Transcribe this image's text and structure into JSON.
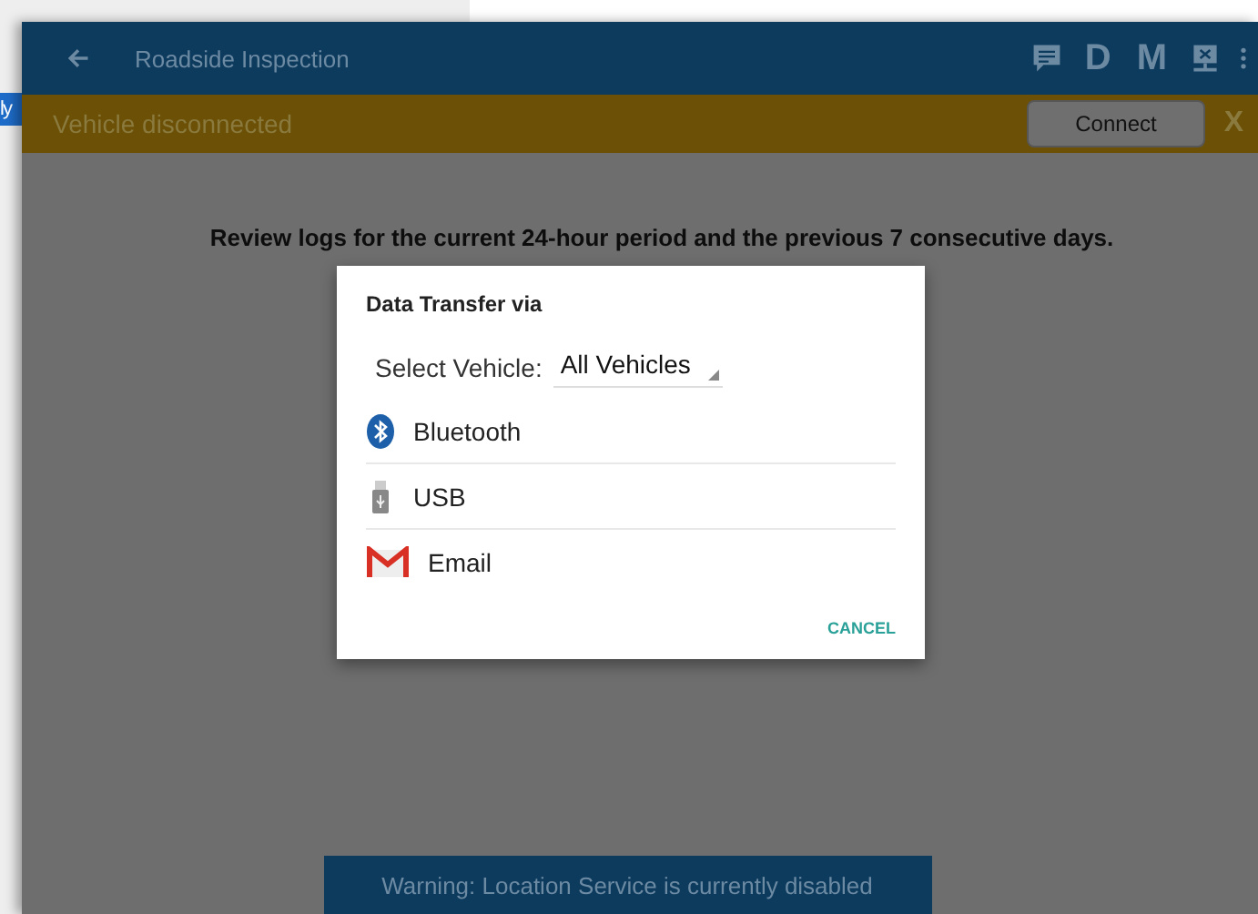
{
  "background_window": {
    "fragment": "ly"
  },
  "window": {
    "title": "Roadside Inspection",
    "actions": [
      "D",
      "M"
    ]
  },
  "banner": {
    "message": "Vehicle disconnected",
    "button": "Connect",
    "close": "X"
  },
  "notice": "Review logs for the current 24-hour period and the previous 7 consecutive days.",
  "dialog": {
    "title": "Data Transfer via",
    "select_label": "Select Vehicle:",
    "select_value": "All Vehicles",
    "options": [
      {
        "kind": "bluetooth",
        "label": "Bluetooth"
      },
      {
        "kind": "usb",
        "label": "USB"
      },
      {
        "kind": "email",
        "label": "Email"
      }
    ],
    "cancel": "CANCEL"
  },
  "warning": "Warning: Location Service is currently disabled"
}
